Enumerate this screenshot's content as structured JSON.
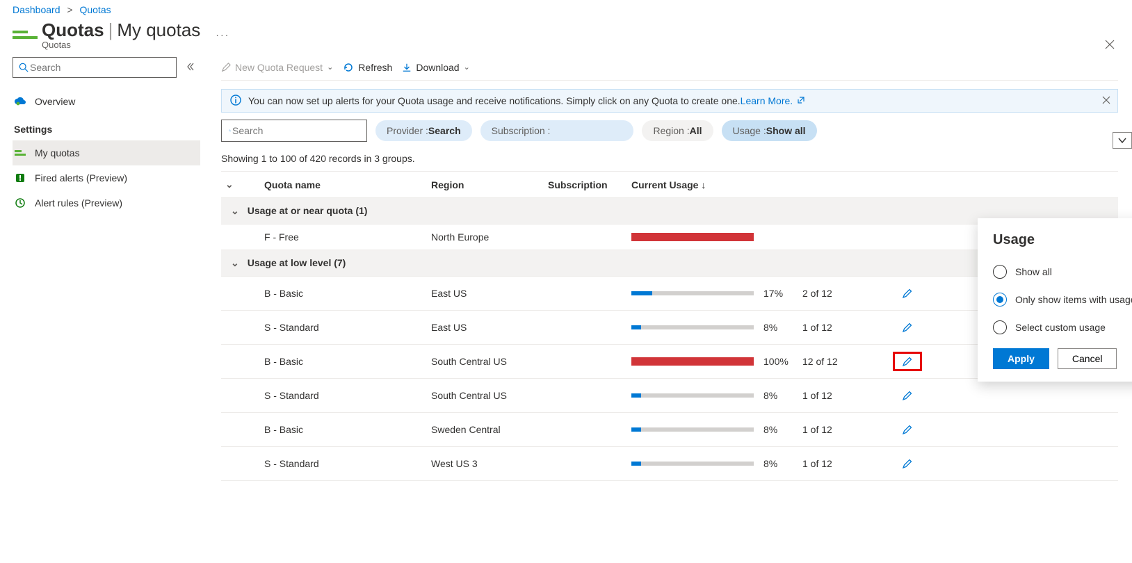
{
  "breadcrumbs": {
    "dashboard": "Dashboard",
    "quotas": "Quotas"
  },
  "header": {
    "title_main": "Quotas",
    "title_sub": "My quotas",
    "subtitle": "Quotas"
  },
  "sidebar": {
    "search_placeholder": "Search",
    "overview": "Overview",
    "settings_label": "Settings",
    "my_quotas": "My quotas",
    "fired_alerts": "Fired alerts (Preview)",
    "alert_rules": "Alert rules (Preview)"
  },
  "toolbar": {
    "new_request": "New Quota Request",
    "refresh": "Refresh",
    "download": "Download"
  },
  "info_bar": {
    "text": "You can now set up alerts for your Quota usage and receive notifications. Simply click on any Quota to create one. ",
    "learn_more": "Learn More."
  },
  "filters": {
    "search_placeholder": "Search",
    "provider_label": "Provider : ",
    "provider_value": "Search",
    "subscription_label": "Subscription :",
    "subscription_value": "",
    "region_label": "Region : ",
    "region_value": "All",
    "usage_label": "Usage : ",
    "usage_value": "Show all"
  },
  "record_count": "Showing 1 to 100 of 420 records in 3 groups.",
  "columns": {
    "quota_name": "Quota name",
    "region": "Region",
    "subscription": "Subscription",
    "current_usage": "Current Usage"
  },
  "groups": [
    {
      "label": "Usage at or near quota (1)",
      "expanded": true
    },
    {
      "label": "Usage at low level (7)",
      "expanded": true
    }
  ],
  "rows": [
    {
      "group": 0,
      "name": "F - Free",
      "region": "North Europe",
      "percent": "",
      "bar_pct": 100,
      "bar_color": "red",
      "of": ""
    },
    {
      "group": 1,
      "name": "B - Basic",
      "region": "East US",
      "percent": "17%",
      "bar_pct": 17,
      "bar_color": "blue",
      "of": "2 of 12"
    },
    {
      "group": 1,
      "name": "S - Standard",
      "region": "East US",
      "percent": "8%",
      "bar_pct": 8,
      "bar_color": "blue",
      "of": "1 of 12"
    },
    {
      "group": 1,
      "name": "B - Basic",
      "region": "South Central US",
      "percent": "100%",
      "bar_pct": 100,
      "bar_color": "red",
      "of": "12  of 12",
      "highlight": true
    },
    {
      "group": 1,
      "name": "S - Standard",
      "region": "South Central US",
      "percent": "8%",
      "bar_pct": 8,
      "bar_color": "blue",
      "of": "1 of 12"
    },
    {
      "group": 1,
      "name": "B - Basic",
      "region": "Sweden Central",
      "percent": "8%",
      "bar_pct": 8,
      "bar_color": "blue",
      "of": "1 of 12"
    },
    {
      "group": 1,
      "name": "S - Standard",
      "region": "West US 3",
      "percent": "8%",
      "bar_pct": 8,
      "bar_color": "blue",
      "of": "1 of 12"
    }
  ],
  "popup": {
    "title": "Usage",
    "opt_show_all": "Show all",
    "opt_only_usage": "Only show items with usage",
    "opt_custom": "Select custom usage",
    "apply": "Apply",
    "cancel": "Cancel"
  }
}
